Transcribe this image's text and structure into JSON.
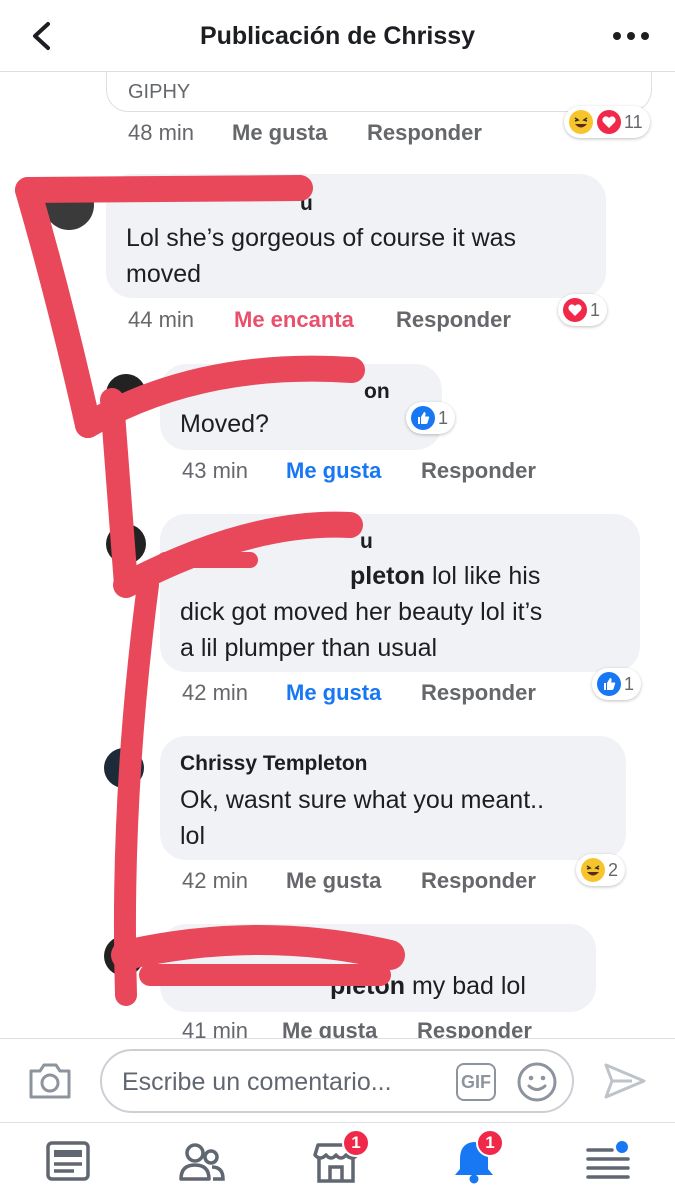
{
  "header": {
    "title": "Publicación de Chrissy"
  },
  "comments": [
    {
      "attachment_label": "GIPHY",
      "time": "48 min",
      "like": "Me gusta",
      "reply": "Responder",
      "reaction_count": "11",
      "reaction_icons": [
        "haha-icon",
        "love-icon"
      ]
    },
    {
      "name_visible": "u",
      "text": "Lol she’s gorgeous of course it was moved",
      "time": "44 min",
      "like": "Me encanta",
      "reply": "Responder",
      "reaction_count": "1",
      "reaction_icons": [
        "love-icon"
      ]
    },
    {
      "name_visible": "on",
      "text": "Moved?",
      "time": "43 min",
      "like": "Me gusta",
      "reply": "Responder",
      "reaction_count": "1",
      "reaction_icons": [
        "like-icon"
      ]
    },
    {
      "name_visible": "u",
      "mention": "pleton",
      "text_line1": " lol like his",
      "text_line2": "dick got moved her beauty  lol it’s",
      "text_line3": "a lil plumper than usual",
      "time": "42 min",
      "like": "Me gusta",
      "reply": "Responder",
      "reaction_count": "1",
      "reaction_icons": [
        "like-icon"
      ]
    },
    {
      "name": "Chrissy Templeton",
      "text_line1": "Ok, wasnt sure what you meant..",
      "text_line2": "lol",
      "time": "42 min",
      "like": "Me gusta",
      "reply": "Responder",
      "reaction_count": "2",
      "reaction_icons": [
        "haha-icon"
      ]
    },
    {
      "mention": "pleton",
      "text": " my bad lol",
      "time": "41 min",
      "like": "Me gusta",
      "reply": "Responder"
    }
  ],
  "composer": {
    "placeholder": "Escribe un comentario...",
    "gif_label": "GIF"
  },
  "tabbar": {
    "marketplace_badge": "1",
    "notifications_badge": "1"
  },
  "colors": {
    "facebook_blue": "#1877f2",
    "love_red": "#e9506b",
    "scribble_red": "#e9475a",
    "meta_gray": "#65676b",
    "bubble_gray": "#f0f2f5"
  }
}
